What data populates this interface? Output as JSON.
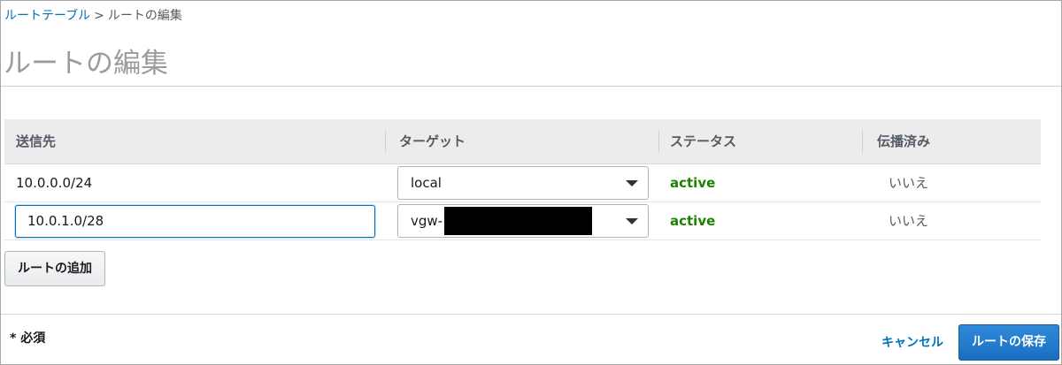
{
  "breadcrumb": {
    "parent": "ルートテーブル",
    "separator": ">",
    "current": "ルートの編集"
  },
  "page_title": "ルートの編集",
  "table": {
    "headers": [
      "送信先",
      "ターゲット",
      "ステータス",
      "伝播済み"
    ],
    "rows": [
      {
        "destination": "10.0.0.0/24",
        "target": "local",
        "status": "active",
        "propagated": "いいえ",
        "editable": false
      },
      {
        "destination": "10.0.1.0/28",
        "target": "vgw-",
        "status": "active",
        "propagated": "いいえ",
        "editable": true
      }
    ]
  },
  "add_route_button": "ルートの追加",
  "required_note": "* 必須",
  "cancel_button": "キャンセル",
  "save_button": "ルートの保存",
  "colors": {
    "link": "#0073bb",
    "status_active": "#1d8102",
    "primary_button": "#1b6ec2"
  },
  "icons": {
    "select_caret": "caret-down-icon"
  }
}
